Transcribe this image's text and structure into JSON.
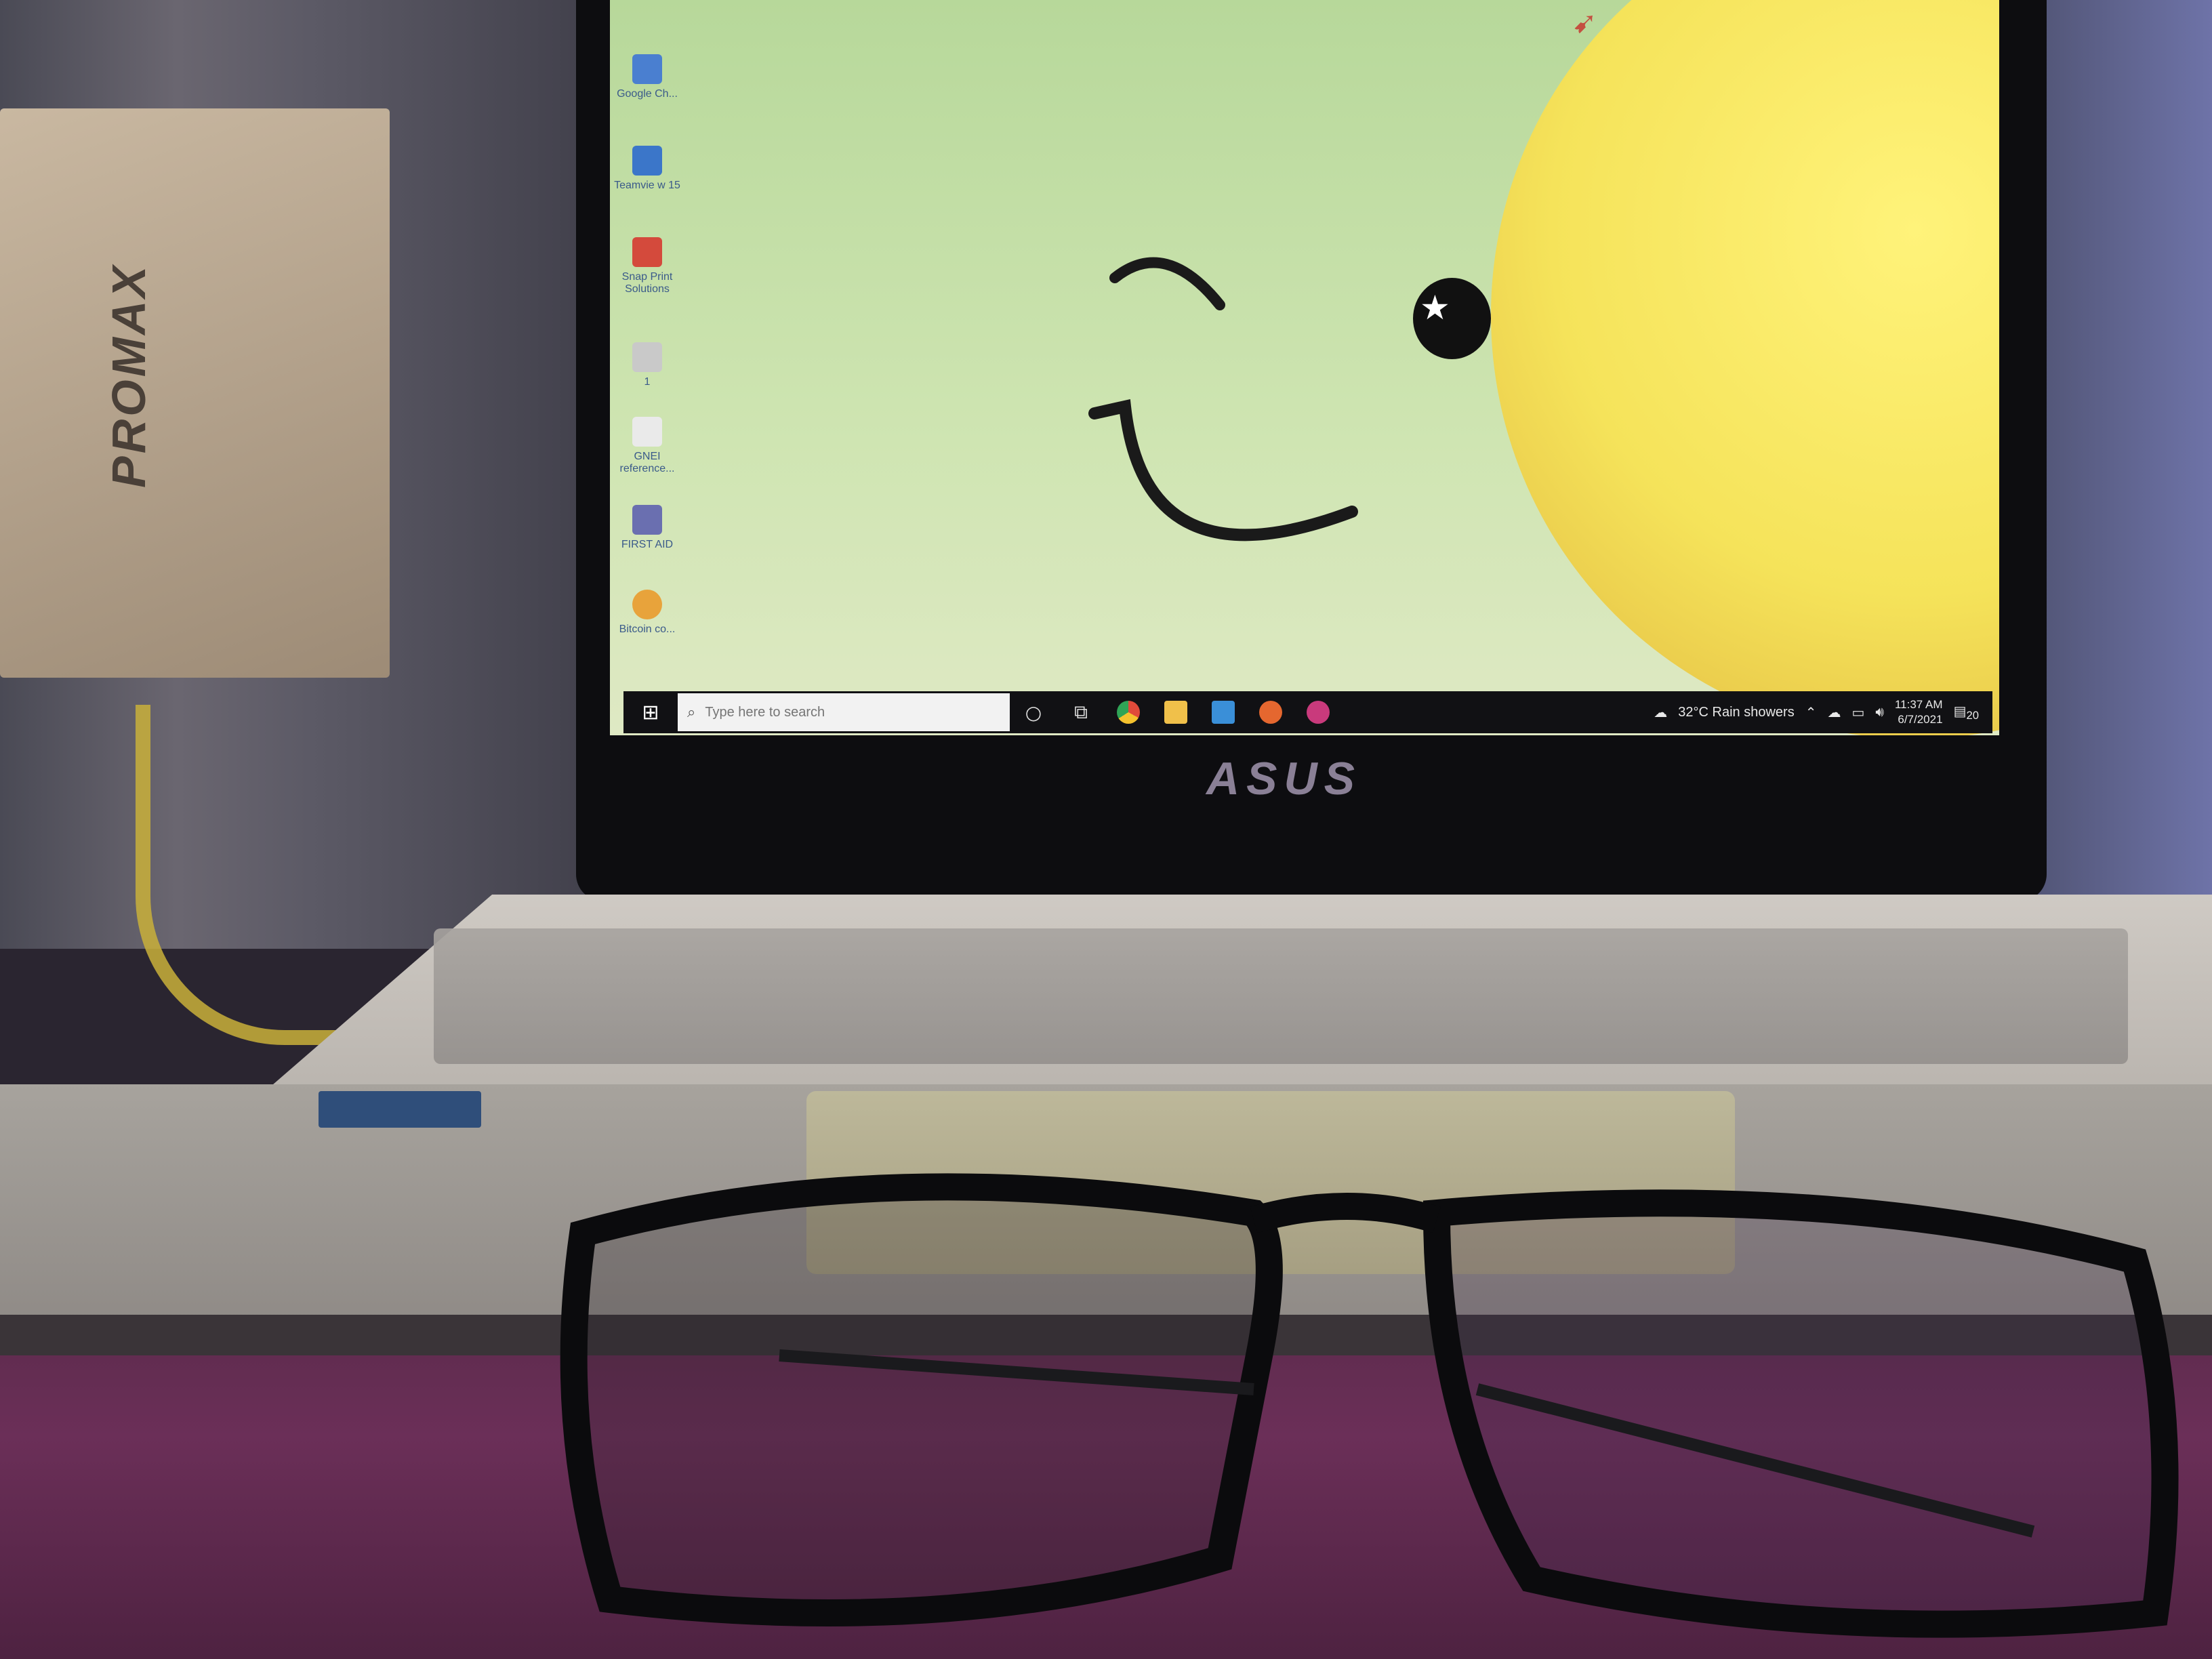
{
  "desktop": {
    "icons": [
      {
        "label": "Google Ch..."
      },
      {
        "label": "Teamvie w 15"
      },
      {
        "label": "Snap Print Solutions"
      },
      {
        "label": "1"
      },
      {
        "label": "GNEI reference..."
      },
      {
        "label": "FIRST AID"
      },
      {
        "label": "Bitcoin co..."
      }
    ]
  },
  "taskbar": {
    "search_placeholder": "Type here to search",
    "weather": "32°C  Rain showers",
    "time": "11:37 AM",
    "date": "6/7/2021",
    "notification_count": "20"
  },
  "laptop": {
    "brand": "ASUS"
  },
  "box": {
    "brand": "PROMAX"
  }
}
